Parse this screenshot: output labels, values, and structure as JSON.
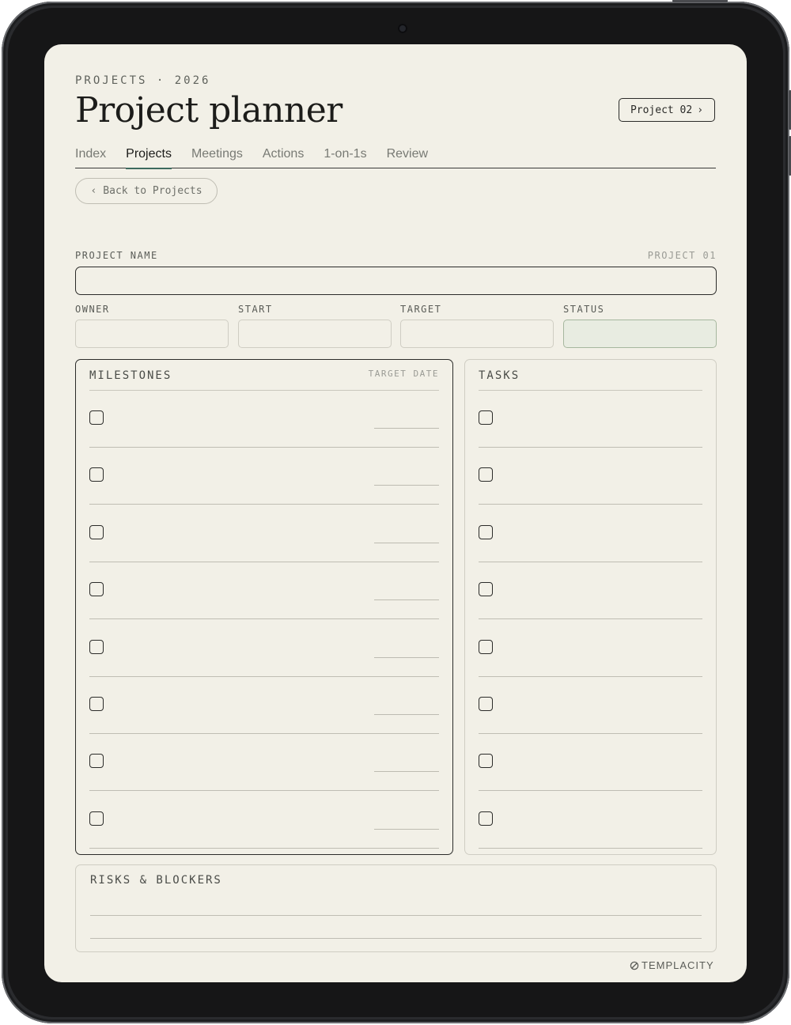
{
  "header": {
    "kicker": "PROJECTS · 2026",
    "title": "Project planner",
    "next_project": {
      "label": "Project 02",
      "icon": "chevron-right-icon"
    }
  },
  "tabs": [
    {
      "label": "Index",
      "active": false
    },
    {
      "label": "Projects",
      "active": true
    },
    {
      "label": "Meetings",
      "active": false
    },
    {
      "label": "Actions",
      "active": false
    },
    {
      "label": "1-on-1s",
      "active": false
    },
    {
      "label": "Review",
      "active": false
    }
  ],
  "back_button": {
    "label": "Back to Projects",
    "icon": "chevron-left-icon"
  },
  "form": {
    "project_name_label": "PROJECT NAME",
    "project_id": "PROJECT 01",
    "project_name_value": "",
    "fields": [
      {
        "label": "OWNER",
        "value": ""
      },
      {
        "label": "START",
        "value": ""
      },
      {
        "label": "TARGET",
        "value": ""
      },
      {
        "label": "STATUS",
        "value": ""
      }
    ]
  },
  "milestones": {
    "heading": "MILESTONES",
    "date_heading": "TARGET DATE",
    "row_count": 8
  },
  "tasks": {
    "heading": "TASKS",
    "row_count": 8
  },
  "risks": {
    "heading": "RISKS & BLOCKERS"
  },
  "footer": {
    "brand": "TEMPLACITY",
    "icon": "templacity-logo-icon"
  },
  "colors": {
    "accent": "#3d6a5e",
    "paper": "#f2f0e7",
    "ink": "#1c1c1a",
    "status_fill": "#e8ece1"
  }
}
